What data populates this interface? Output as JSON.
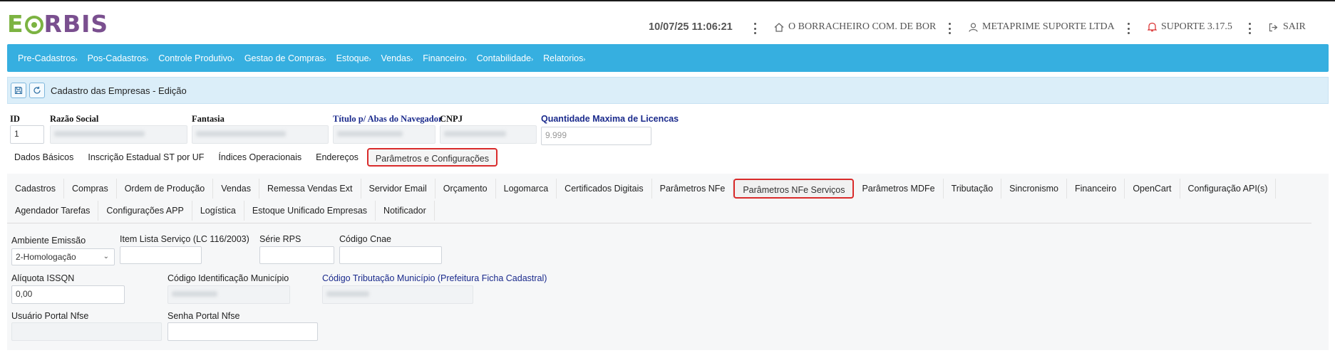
{
  "app": {
    "logo_e": "E",
    "logo_rest": "RBIS"
  },
  "header": {
    "datetime": "10/07/25 11:06:21",
    "company": "O BORRACHEIRO COM. DE BOR",
    "user": "METAPRIME SUPORTE LTDA",
    "support": "SUPORTE 3.17.5",
    "logout": "SAIR",
    "support_color": "#d92b2b"
  },
  "menu": [
    "Pre-Cadastros",
    "Pos-Cadastros",
    "Controle Produtivo",
    "Gestao de Compras",
    "Estoque",
    "Vendas",
    "Financeiro",
    "Contabilidade",
    "Relatorios"
  ],
  "toolbar": {
    "title": "Cadastro das Empresas - Edição"
  },
  "company_fields": {
    "id_label": "ID",
    "id_value": "1",
    "razao_label": "Razão Social",
    "fantasia_label": "Fantasia",
    "titulo_label": "Título p/ Abas do Navegador",
    "cnpj_label": "CNPJ",
    "licencas_label": "Quantidade Maxima de Licencas",
    "licencas_value": "9.999"
  },
  "main_tabs": [
    "Dados Básicos",
    "Inscrição Estadual ST por UF",
    "Índices Operacionais",
    "Endereços",
    "Parâmetros e Configurações"
  ],
  "sub_tabs_row1": [
    "Cadastros",
    "Compras",
    "Ordem de Produção",
    "Vendas",
    "Remessa Vendas Ext",
    "Servidor Email",
    "Orçamento",
    "Logomarca",
    "Certificados Digitais",
    "Parâmetros NFe",
    "Parâmetros NFe Serviços",
    "Parâmetros MDFe",
    "Tributação",
    "Sincronismo",
    "Financeiro",
    "OpenCart",
    "Configuração API(s)"
  ],
  "sub_tabs_row2": [
    "Agendador Tarefas",
    "Configurações APP",
    "Logística",
    "Estoque Unificado Empresas",
    "Notificador"
  ],
  "nfse": {
    "ambiente_label": "Ambiente Emissão",
    "ambiente_value": "2-Homologação",
    "item_lista_label": "Item Lista Serviço (LC 116/2003)",
    "serie_rps_label": "Série RPS",
    "cnae_label": "Código Cnae",
    "aliquota_label": "Alíquota ISSQN",
    "aliquota_value": "0,00",
    "cod_municipio_label": "Código Identificação Município",
    "cod_tributacao_label": "Código Tributação Município (Prefeitura Ficha Cadastral)",
    "usuario_label": "Usuário Portal Nfse",
    "senha_label": "Senha Portal Nfse"
  }
}
